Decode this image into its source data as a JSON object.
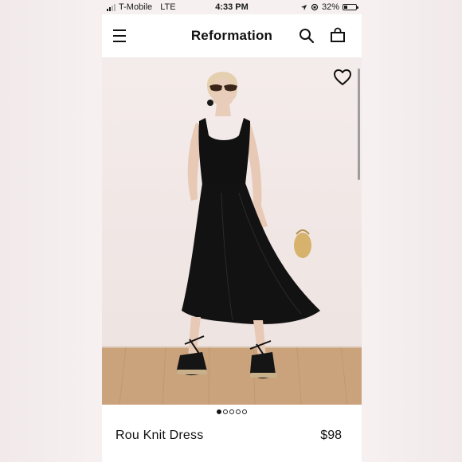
{
  "status_bar": {
    "carrier": "T-Mobile",
    "network": "LTE",
    "time": "4:33 PM",
    "battery": "32%",
    "battery_level": 0.32
  },
  "header": {
    "brand": "Reformation"
  },
  "product": {
    "name": "Rou Knit Dress",
    "price": "$98",
    "image_count": 5,
    "active_image": 1
  },
  "colors": {
    "dress": "#111111",
    "background": "#f4eceb",
    "floor": "#c9a27a"
  },
  "icons": {
    "menu": "hamburger-icon",
    "search": "search-icon",
    "bag": "shopping-bag-icon",
    "wishlist": "heart-icon"
  }
}
